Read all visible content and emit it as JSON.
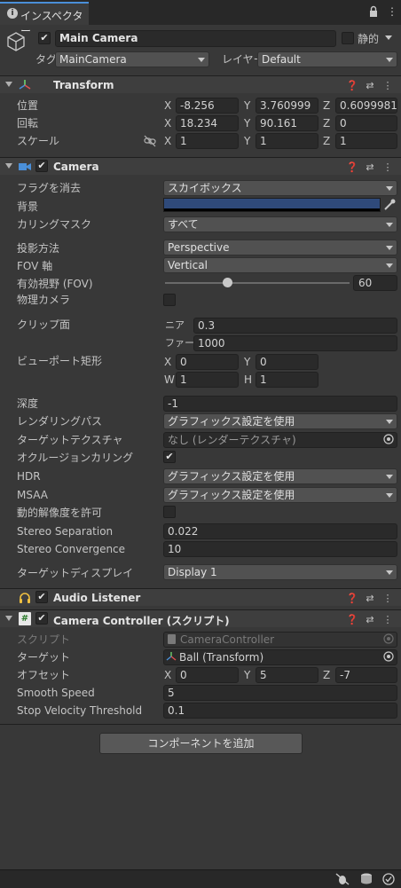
{
  "tab": {
    "title": "インスペクター"
  },
  "gameobject": {
    "name": "Main Camera",
    "static_label": "静的",
    "tag_label": "タグ",
    "tag_value": "MainCamera",
    "layer_label": "レイヤー",
    "layer_value": "Default"
  },
  "transform": {
    "title": "Transform",
    "position_label": "位置",
    "rotation_label": "回転",
    "scale_label": "スケール",
    "axes": {
      "x": "X",
      "y": "Y",
      "z": "Z"
    },
    "position": {
      "x": "-8.256",
      "y": "3.760999",
      "z": "0.6099981"
    },
    "rotation": {
      "x": "18.234",
      "y": "90.161",
      "z": "0"
    },
    "scale": {
      "x": "1",
      "y": "1",
      "z": "1"
    }
  },
  "camera": {
    "title": "Camera",
    "clear_flags_label": "フラグを消去",
    "clear_flags_value": "スカイボックス",
    "background_label": "背景",
    "background_color": "#2f4a7a",
    "culling_label": "カリングマスク",
    "culling_value": "すべて",
    "projection_label": "投影方法",
    "projection_value": "Perspective",
    "fov_axis_label": "FOV 軸",
    "fov_axis_value": "Vertical",
    "fov_label": "有効視野 (FOV)",
    "fov_value": "60",
    "fov_fraction": 0.33,
    "physical_label": "物理カメラ",
    "clip_label": "クリップ面",
    "near_label": "ニア",
    "near_value": "0.3",
    "far_label": "ファー",
    "far_value": "1000",
    "viewport_label": "ビューポート矩形",
    "vp_x_label": "X",
    "vp_x": "0",
    "vp_y_label": "Y",
    "vp_y": "0",
    "vp_w_label": "W",
    "vp_w": "1",
    "vp_h_label": "H",
    "vp_h": "1",
    "depth_label": "深度",
    "depth_value": "-1",
    "rendering_path_label": "レンダリングパス",
    "rendering_path_value": "グラフィックス設定を使用",
    "target_texture_label": "ターゲットテクスチャ",
    "target_texture_value": "なし (レンダーテクスチャ)",
    "occlusion_label": "オクルージョンカリング",
    "hdr_label": "HDR",
    "hdr_value": "グラフィックス設定を使用",
    "msaa_label": "MSAA",
    "msaa_value": "グラフィックス設定を使用",
    "dynamic_res_label": "動的解像度を許可",
    "stereo_sep_label": "Stereo Separation",
    "stereo_sep_value": "0.022",
    "stereo_conv_label": "Stereo Convergence",
    "stereo_conv_value": "10",
    "target_display_label": "ターゲットディスプレイ",
    "target_display_value": "Display 1"
  },
  "audio_listener": {
    "title": "Audio Listener"
  },
  "camera_controller": {
    "title": "Camera Controller (スクリプト)",
    "script_label": "スクリプト",
    "script_value": "CameraController",
    "target_label": "ターゲット",
    "target_value": "Ball (Transform)",
    "offset_label": "オフセット",
    "offset": {
      "x": "0",
      "y": "5",
      "z": "-7"
    },
    "smooth_label": "Smooth Speed",
    "smooth_value": "5",
    "stop_label": "Stop Velocity Threshold",
    "stop_value": "0.1"
  },
  "add_component": "コンポーネントを追加",
  "colors": {
    "background": "#383838",
    "header": "#3e3e3e",
    "field": "#2a2a2a",
    "accent_blue": "#4a8fd8"
  }
}
